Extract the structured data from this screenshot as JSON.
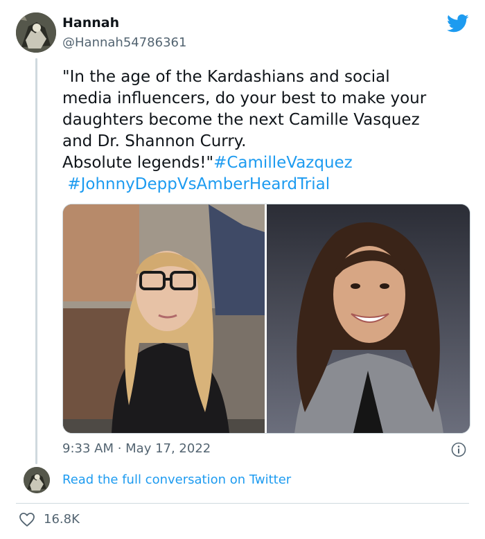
{
  "author": {
    "display_name": "Hannah",
    "handle": "@Hannah54786361"
  },
  "tweet": {
    "text": "\"In the age of the Kardashians and social\nmedia influencers, do your best to make your\ndaughters become the next Camille Vasquez\nand Dr. Shannon Curry.\nAbsolute legends!\"",
    "hashtags": [
      "#CamilleVazquez",
      "#JohnnyDeppVsAmberHeardTrial"
    ],
    "timestamp": "9:33 AM · May 17, 2022"
  },
  "media": {
    "photos": [
      "woman-with-glasses-in-courtroom-photo",
      "smiling-woman-portrait-photo"
    ]
  },
  "footer": {
    "read_link": "Read the full conversation on Twitter",
    "like_count": "16.8K"
  },
  "colors": {
    "accent": "#1d9bf0",
    "secondary_text": "#536471",
    "border": "#cfd9de"
  }
}
